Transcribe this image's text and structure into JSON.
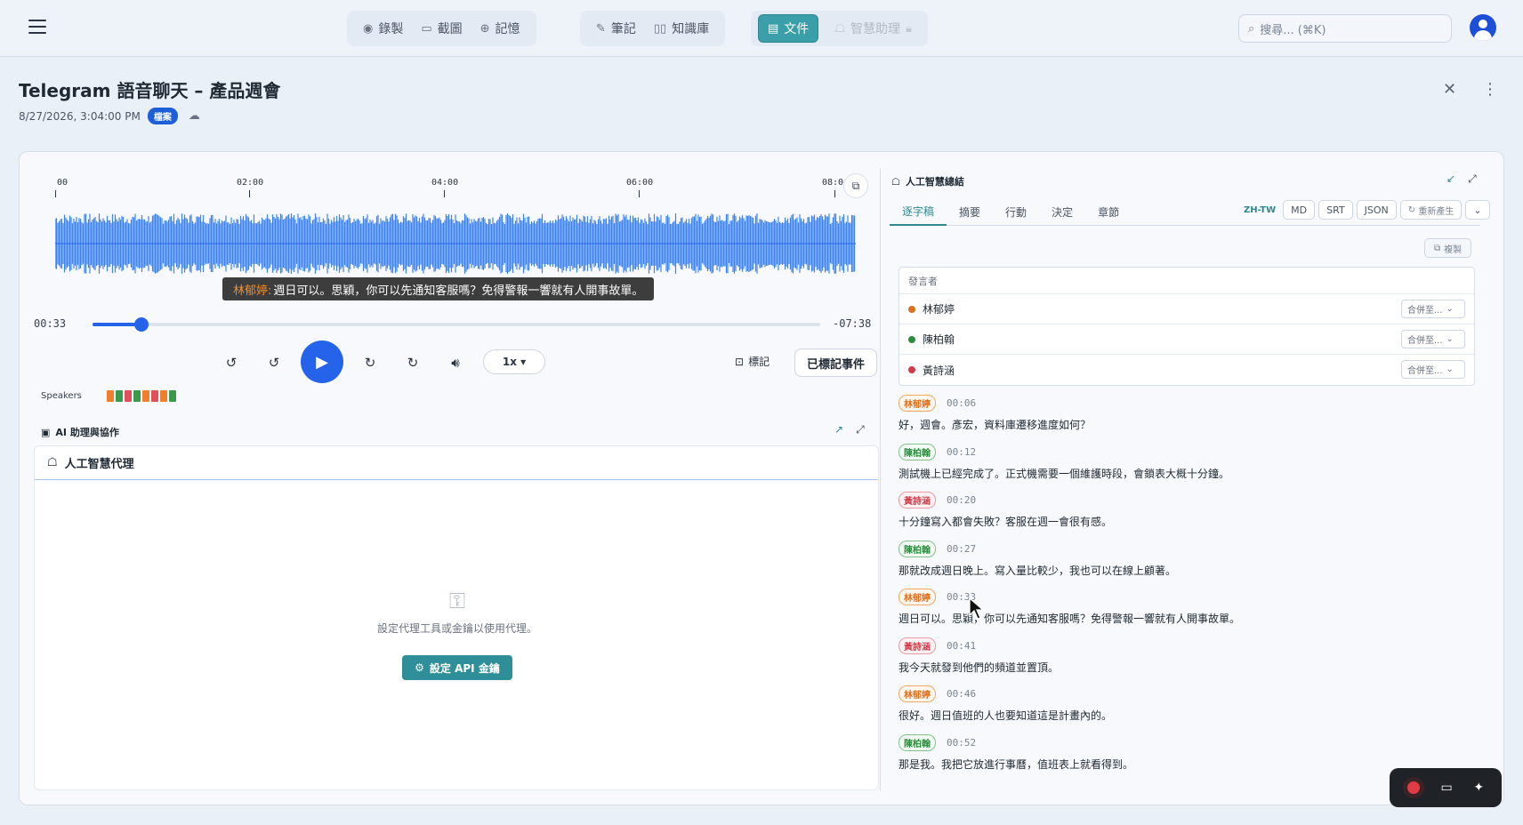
{
  "nav": {
    "group1": [
      {
        "label": "錄製",
        "icon": "record-icon"
      },
      {
        "label": "截圖",
        "icon": "screenshot-icon"
      },
      {
        "label": "記憶",
        "icon": "memory-icon"
      }
    ],
    "group2": [
      {
        "label": "筆記",
        "icon": "notes-icon"
      },
      {
        "label": "知識庫",
        "icon": "book-icon"
      }
    ],
    "group3": [
      {
        "label": "文件",
        "icon": "documents-icon",
        "active": true
      },
      {
        "label": "智慧助理",
        "icon": "assistant-icon",
        "disabled": true
      }
    ],
    "search_placeholder": "搜尋... (⌘K)"
  },
  "doc": {
    "title": "Telegram 語音聊天 – 產品週會",
    "date": "8/27/2026, 3:04:00 PM",
    "badge": "檔案"
  },
  "player": {
    "ticks": [
      "00",
      "02:00",
      "04:00",
      "06:00",
      "08:0"
    ],
    "caption_speaker": "林郁婷:",
    "caption_text": "週日可以。思穎，你可以先通知客服嗎？免得警報一響就有人開事故單。",
    "elapsed": "00:33",
    "remaining": "-07:38",
    "progress_fraction": 0.067,
    "speed": "1x ▾",
    "mark_label": "標記",
    "marked_events_label": "已標記事件",
    "speakers_label": "Speakers",
    "speaker_swatches": [
      "#f07f2d",
      "#3a9a4a",
      "#e0505c",
      "#3a9a4a",
      "#f07f2d",
      "#e0505c",
      "#f07f2d",
      "#3a9a4a"
    ]
  },
  "assist": {
    "header": "AI 助理與協作",
    "agent_title": "人工智慧代理",
    "empty_message": "設定代理工具或金鑰以使用代理。",
    "api_button": "設定 API 金鑰"
  },
  "summary": {
    "title": "人工智慧總結",
    "tabs": [
      "逐字稿",
      "摘要",
      "行動",
      "決定",
      "章節"
    ],
    "lang": "ZH-TW",
    "formats": [
      "MD",
      "SRT",
      "JSON"
    ],
    "regenerate": "重新產生",
    "copy": "複製",
    "speaker_header": "發言者",
    "merge_label": "合併至...",
    "speakers": [
      {
        "name": "林郁婷",
        "color": "#e0701f"
      },
      {
        "name": "陳柏翰",
        "color": "#2e8b3e"
      },
      {
        "name": "黃詩涵",
        "color": "#d23a48"
      }
    ],
    "transcript": [
      {
        "speaker": "林郁婷",
        "cls": "c-lin",
        "time": "00:06",
        "text": "好，週會。彥宏，資料庫遷移進度如何？"
      },
      {
        "speaker": "陳柏翰",
        "cls": "c-chen",
        "time": "00:12",
        "text": "測試機上已經完成了。正式機需要一個維護時段，會鎖表大概十分鐘。"
      },
      {
        "speaker": "黃詩涵",
        "cls": "c-huang",
        "time": "00:20",
        "text": "十分鐘寫入都會失敗？客服在週一會很有感。"
      },
      {
        "speaker": "陳柏翰",
        "cls": "c-chen",
        "time": "00:27",
        "text": "那就改成週日晚上。寫入量比較少，我也可以在線上顧著。"
      },
      {
        "speaker": "林郁婷",
        "cls": "c-lin",
        "time": "00:33",
        "text": "週日可以。思穎，你可以先通知客服嗎？免得警報一響就有人開事故單。"
      },
      {
        "speaker": "黃詩涵",
        "cls": "c-huang",
        "time": "00:41",
        "text": "我今天就發到他們的頻道並置頂。"
      },
      {
        "speaker": "林郁婷",
        "cls": "c-lin",
        "time": "00:46",
        "text": "很好。週日值班的人也要知道這是計畫內的。"
      },
      {
        "speaker": "陳柏翰",
        "cls": "c-chen",
        "time": "00:52",
        "text": "那是我。我把它放進行事曆，值班表上就看得到。"
      }
    ]
  }
}
